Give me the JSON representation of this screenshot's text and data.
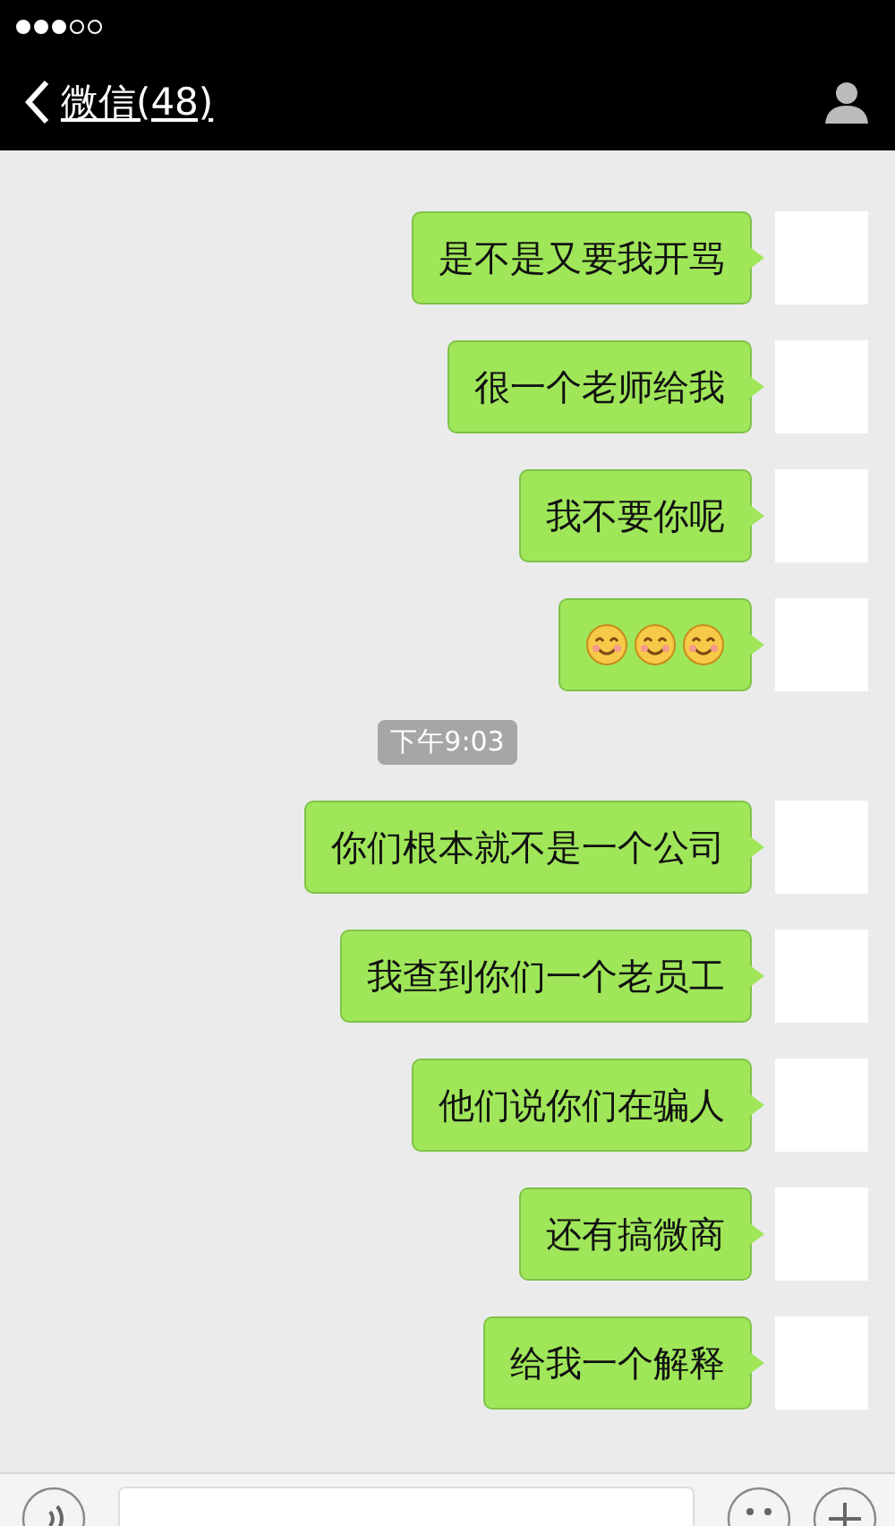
{
  "status_bar": {
    "signal_dots": [
      {
        "filled": true
      },
      {
        "filled": true
      },
      {
        "filled": true
      },
      {
        "filled": false
      },
      {
        "filled": false
      }
    ]
  },
  "nav_bar": {
    "back_label": "微信(48)"
  },
  "messages": [
    {
      "kind": "text",
      "text": "是不是又要我开骂"
    },
    {
      "kind": "text",
      "text": "很一个老师给我"
    },
    {
      "kind": "text",
      "text": "我不要你呢"
    },
    {
      "kind": "emoji",
      "emojis": [
        {
          "kind": "smile"
        },
        {
          "kind": "smile"
        },
        {
          "kind": "smile"
        }
      ]
    },
    {
      "kind": "time",
      "text": "下午9:03"
    },
    {
      "kind": "text",
      "text": "你们根本就不是一个公司"
    },
    {
      "kind": "text",
      "text": "我查到你们一个老员工"
    },
    {
      "kind": "text",
      "text": "他们说你们在骗人"
    },
    {
      "kind": "text",
      "text": "还有搞微商"
    },
    {
      "kind": "text",
      "text": "给我一个解释"
    }
  ]
}
